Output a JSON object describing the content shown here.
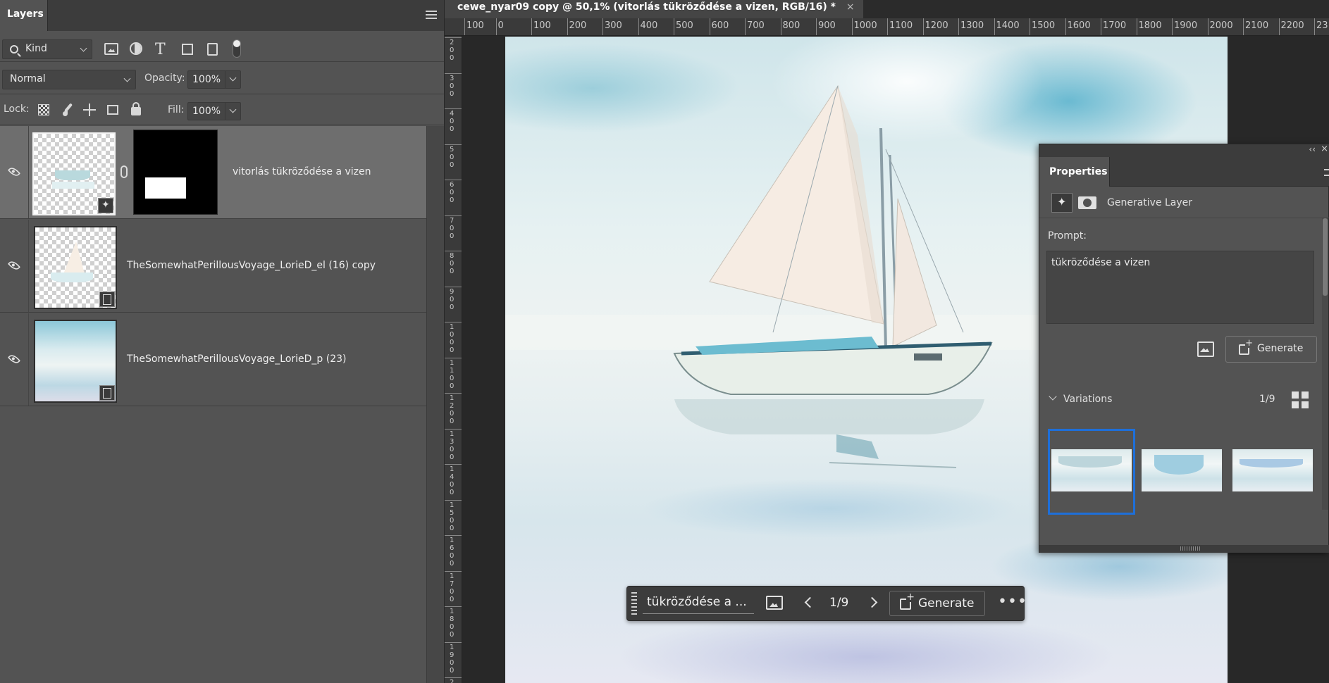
{
  "layers_panel": {
    "tab_label": "Layers",
    "filter_kind": "Kind",
    "blend_mode": "Normal",
    "opacity_label": "Opacity:",
    "opacity_value": "100%",
    "lock_label": "Lock:",
    "fill_label": "Fill:",
    "fill_value": "100%",
    "layers": [
      {
        "name": "vitorlás tükröződése a vizen",
        "type": "generative",
        "selected": true,
        "visible": true,
        "has_mask": true
      },
      {
        "name": "TheSomewhatPerillousVoyage_LorieD_el (16) copy",
        "type": "smart-object",
        "selected": false,
        "visible": true
      },
      {
        "name": "TheSomewhatPerillousVoyage_LorieD_p (23)",
        "type": "smart-object",
        "selected": false,
        "visible": true
      }
    ]
  },
  "document": {
    "tab_title": "cewe_nyar09 copy @ 50,1% (vitorlás tükröződése a vizen, RGB/16) *",
    "close_glyph": "×",
    "ruler_top_labels": [
      "100",
      "0",
      "100",
      "200",
      "300",
      "400",
      "500",
      "600",
      "700",
      "800",
      "900",
      "1000",
      "1100",
      "1200",
      "1300",
      "1400",
      "1500",
      "1600",
      "1700",
      "1800",
      "1900",
      "2000",
      "2100",
      "2200",
      "23"
    ],
    "ruler_left_labels": [
      "2\n0\n0",
      "3\n0\n0",
      "4\n0\n0",
      "5\n0\n0",
      "6\n0\n0",
      "7\n0\n0",
      "8\n0\n0",
      "9\n0\n0",
      "1\n0\n0\n0",
      "1\n1\n0\n0",
      "1\n2\n0\n0",
      "1\n3\n0\n0",
      "1\n4\n0\n0",
      "1\n5\n0\n0",
      "1\n6\n0\n0",
      "1\n7\n0\n0",
      "1\n8\n0\n0",
      "1\n9\n0\n0",
      "2"
    ]
  },
  "context_bar": {
    "prompt": "tükröződése a ...",
    "variation_counter": "1/9",
    "generate_label": "Generate",
    "more_label": "•••"
  },
  "properties_panel": {
    "collapse_glyph": "‹‹",
    "close_glyph": "×",
    "tab_label": "Properties",
    "layer_type_label": "Generative Layer",
    "prompt_label": "Prompt:",
    "prompt_value": "tükröződése a vizen",
    "generate_label": "Generate",
    "variations_label": "Variations",
    "variations_counter": "1/9",
    "selected_variation": 1
  },
  "colors": {
    "panel_bg": "#535353",
    "selected_layer_bg": "#6e6e6e",
    "accent_selection": "#1e6fd9",
    "canvas_bg": "#282828"
  },
  "icons": [
    "search-icon",
    "pixel-layer-filter-icon",
    "adjustment-layer-filter-icon",
    "type-layer-filter-icon",
    "shape-layer-filter-icon",
    "smart-object-filter-icon",
    "filter-toggle-icon",
    "lock-transparent-icon",
    "lock-image-icon",
    "lock-position-icon",
    "lock-artboard-icon",
    "lock-all-icon",
    "eye-icon",
    "link-icon",
    "generative-badge-icon",
    "smart-object-badge-icon",
    "reference-image-icon",
    "chevron-left-icon",
    "chevron-right-icon",
    "generate-icon",
    "more-icon",
    "mask-icon",
    "grid-view-icon",
    "hamburger-menu-icon"
  ]
}
